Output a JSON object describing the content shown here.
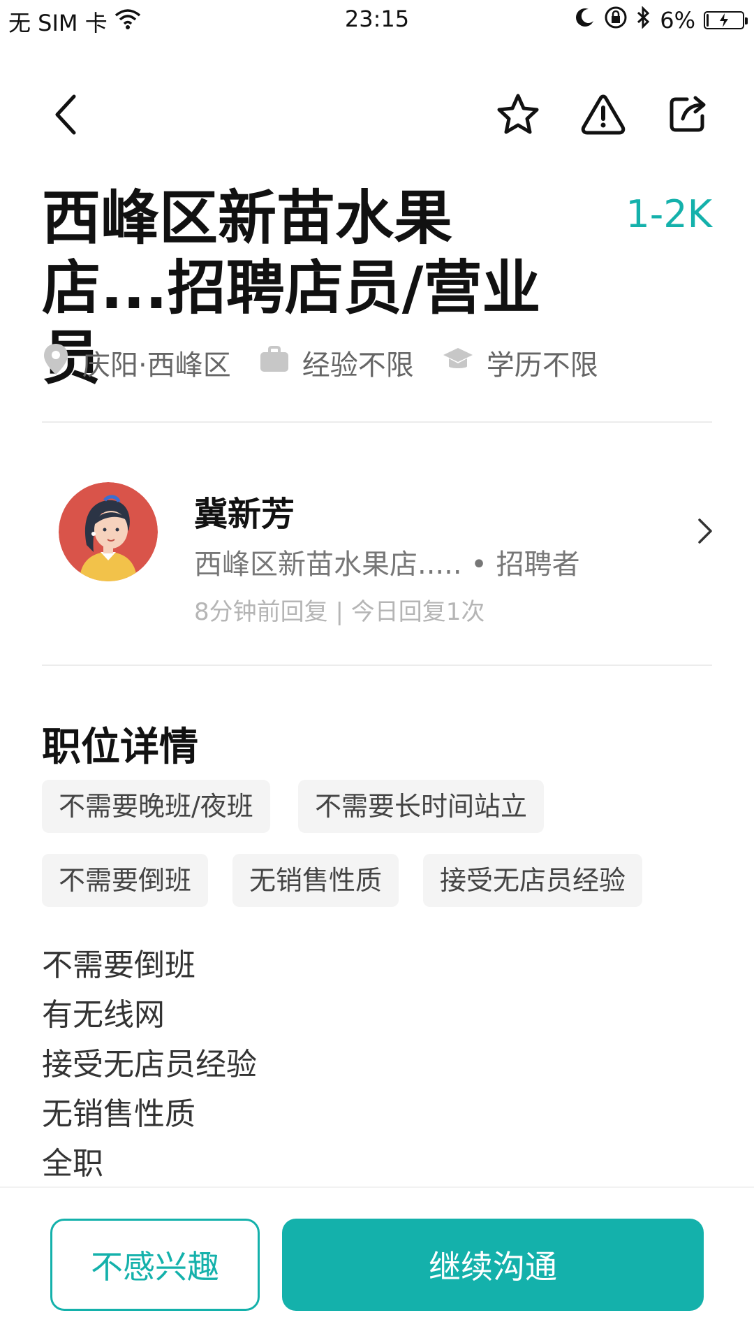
{
  "status_bar": {
    "carrier": "无 SIM 卡",
    "time": "23:15",
    "battery_percent": "6%",
    "battery_level": 0.06
  },
  "nav": {
    "icons": [
      "back-icon",
      "star-icon",
      "alert-icon",
      "share-icon"
    ]
  },
  "job": {
    "title": "西峰区新苗水果店...招聘店员/营业员",
    "salary": "1-2K",
    "location": "庆阳·西峰区",
    "experience": "经验不限",
    "education": "学历不限"
  },
  "recruiter": {
    "name": "冀新芳",
    "company_role": "西峰区新苗水果店..... • 招聘者",
    "reply_info": "8分钟前回复 | 今日回复1次"
  },
  "details": {
    "section_title": "职位详情",
    "tags": [
      "不需要晚班/夜班",
      "不需要长时间站立",
      "不需要倒班",
      "无销售性质",
      "接受无店员经验"
    ],
    "lines": [
      "不需要倒班",
      "有无线网",
      "接受无店员经验",
      "无销售性质",
      "全职"
    ]
  },
  "actions": {
    "not_interested": "不感兴趣",
    "continue_chat": "继续沟通"
  },
  "colors": {
    "accent": "#14b1ab"
  }
}
